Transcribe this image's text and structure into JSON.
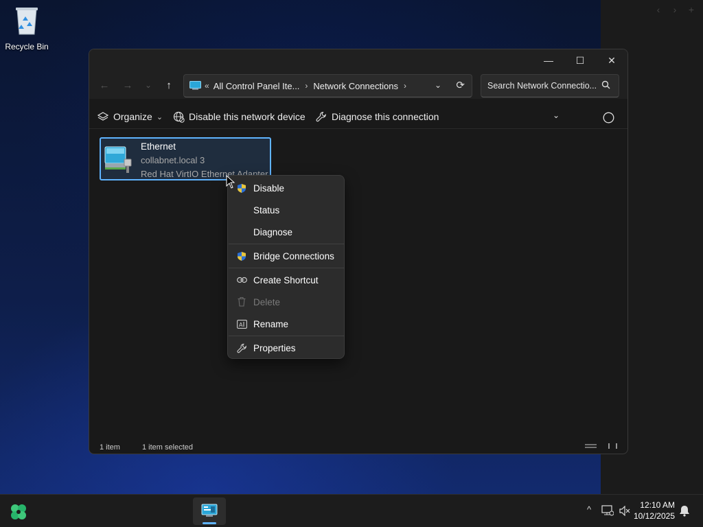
{
  "desktop": {
    "recycle_bin_label": "Recycle Bin"
  },
  "window": {
    "controls": {
      "minimize": "—",
      "maximize": "☐",
      "close": "✕"
    },
    "nav": {
      "back": "←",
      "forward": "→",
      "recent": "⌄",
      "up": "↑"
    },
    "address": {
      "overflow": "«",
      "segments": [
        "All Control Panel Ite...",
        "Network Connections"
      ],
      "separator": "›",
      "dropdown": "⌄",
      "refresh": "⟳"
    },
    "search": {
      "placeholder": "Search Network Connectio...",
      "icon": "search-icon"
    },
    "commands": {
      "organize": "Organize",
      "disable_device": "Disable this network device",
      "diagnose": "Diagnose this connection",
      "more_chevron": "⌄"
    },
    "item": {
      "name": "Ethernet",
      "network": "collabnet.local 3",
      "adapter": "Red Hat VirtIO Ethernet Adapter"
    },
    "status": {
      "count": "1 item",
      "selected": "1 item selected"
    }
  },
  "context_menu": {
    "items": [
      {
        "label": "Disable",
        "icon": "shield-icon",
        "enabled": true
      },
      {
        "label": "Status",
        "icon": "",
        "enabled": true
      },
      {
        "label": "Diagnose",
        "icon": "",
        "enabled": true
      },
      {
        "label": "Bridge Connections",
        "icon": "shield-icon",
        "enabled": true
      },
      {
        "label": "Create Shortcut",
        "icon": "link-icon",
        "enabled": true
      },
      {
        "label": "Delete",
        "icon": "trash-icon",
        "enabled": false
      },
      {
        "label": "Rename",
        "icon": "rename-icon",
        "enabled": true
      },
      {
        "label": "Properties",
        "icon": "wrench-icon",
        "enabled": true
      }
    ]
  },
  "taskbar": {
    "clock_time": "12:10 AM",
    "clock_date": "10/12/2025",
    "tray_chevron": "^"
  },
  "colors": {
    "accent": "#60b4ff",
    "menu_bg": "#2c2c2c",
    "window_bg": "#191919"
  }
}
